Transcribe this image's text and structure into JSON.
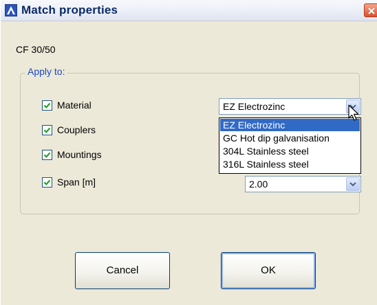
{
  "window": {
    "title": "Match properties"
  },
  "item_name": "CF 30/50",
  "apply_group": {
    "legend": "Apply to:",
    "options": [
      {
        "label": "Material",
        "checked": true
      },
      {
        "label": "Couplers",
        "checked": true
      },
      {
        "label": "Mountings",
        "checked": true
      },
      {
        "label": "Span [m]",
        "checked": true
      }
    ]
  },
  "material_combo": {
    "value": "EZ Electrozinc",
    "open": true,
    "options": [
      "EZ Electrozinc",
      "GC Hot dip galvanisation",
      "304L Stainless steel",
      "316L Stainless steel"
    ],
    "highlighted_index": 0
  },
  "span_combo": {
    "value": "2.00"
  },
  "buttons": {
    "cancel": "Cancel",
    "ok": "OK"
  },
  "colors": {
    "legend": "#1c47c8",
    "selection": "#316ac5",
    "checkmark": "#21a121",
    "window_bg": "#ece9d8"
  },
  "icons": {
    "app": "app-logo-icon",
    "close": "close-icon",
    "combo_arrow": "chevron-down-icon",
    "check": "checkmark-icon",
    "cursor": "mouse-pointer-icon"
  }
}
